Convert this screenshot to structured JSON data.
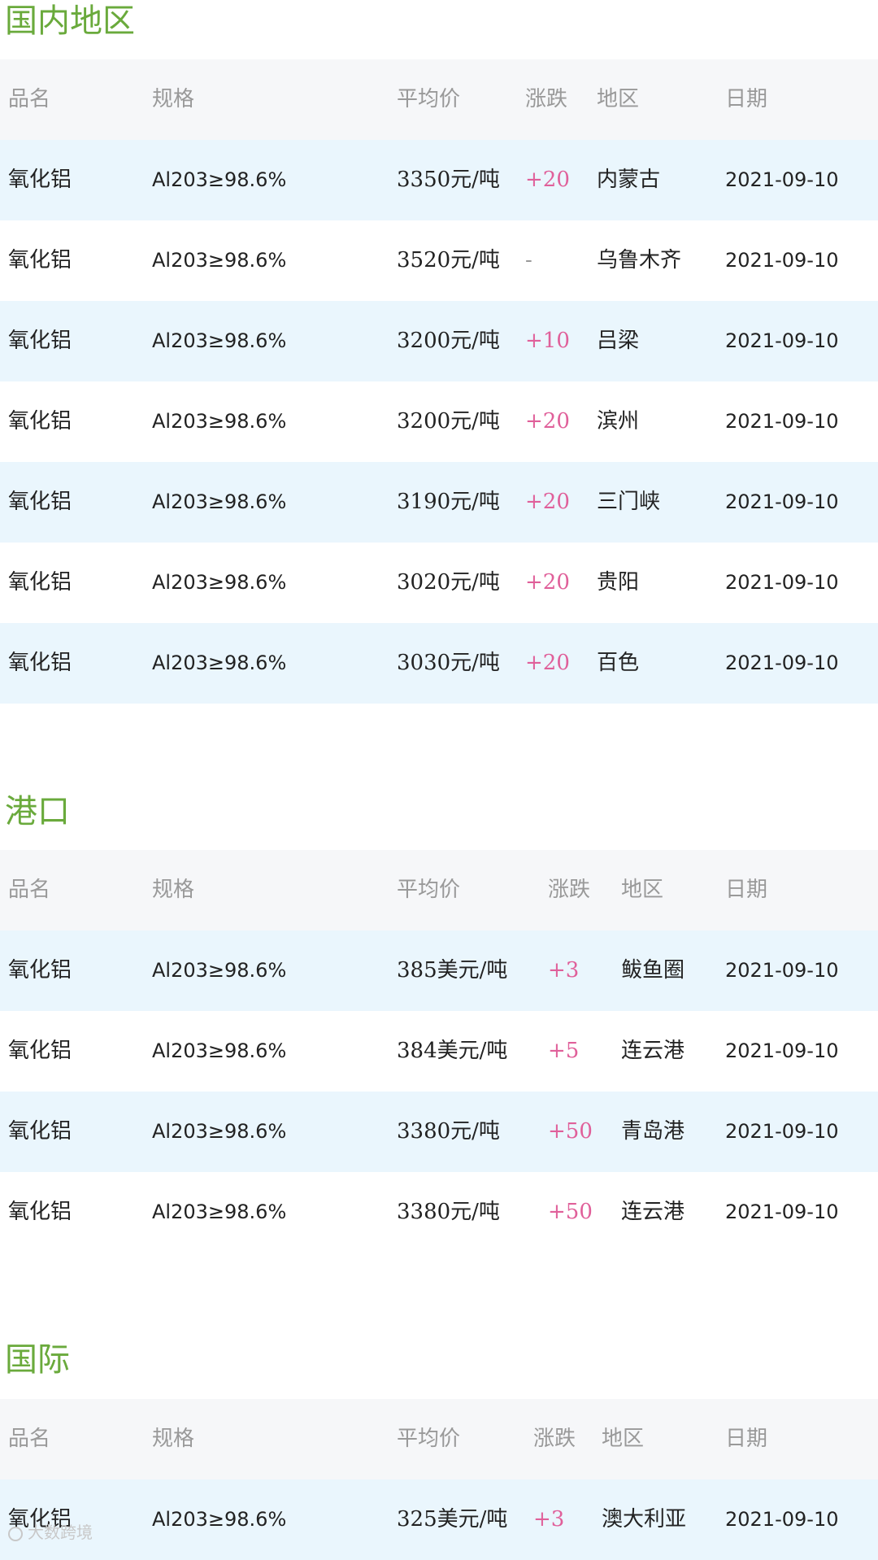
{
  "headers": {
    "name": "品名",
    "spec": "规格",
    "price": "平均价",
    "change": "涨跌",
    "region": "地区",
    "date": "日期"
  },
  "domestic": {
    "title": "国内地区",
    "rows": [
      {
        "name": "氧化铝",
        "spec": "Al203≥98.6%",
        "price": "3350元/吨",
        "change": "+20",
        "region": "内蒙古",
        "date": "2021-09-10"
      },
      {
        "name": "氧化铝",
        "spec": "Al203≥98.6%",
        "price": "3520元/吨",
        "change": "-",
        "region": "乌鲁木齐",
        "date": "2021-09-10"
      },
      {
        "name": "氧化铝",
        "spec": "Al203≥98.6%",
        "price": "3200元/吨",
        "change": "+10",
        "region": "吕梁",
        "date": "2021-09-10"
      },
      {
        "name": "氧化铝",
        "spec": "Al203≥98.6%",
        "price": "3200元/吨",
        "change": "+20",
        "region": "滨州",
        "date": "2021-09-10"
      },
      {
        "name": "氧化铝",
        "spec": "Al203≥98.6%",
        "price": "3190元/吨",
        "change": "+20",
        "region": "三门峡",
        "date": "2021-09-10"
      },
      {
        "name": "氧化铝",
        "spec": "Al203≥98.6%",
        "price": "3020元/吨",
        "change": "+20",
        "region": "贵阳",
        "date": "2021-09-10"
      },
      {
        "name": "氧化铝",
        "spec": "Al203≥98.6%",
        "price": "3030元/吨",
        "change": "+20",
        "region": "百色",
        "date": "2021-09-10"
      }
    ]
  },
  "port": {
    "title": "港口",
    "rows": [
      {
        "name": "氧化铝",
        "spec": "Al203≥98.6%",
        "price": "385美元/吨",
        "change": "+3",
        "region": "鲅鱼圈",
        "date": "2021-09-10"
      },
      {
        "name": "氧化铝",
        "spec": "Al203≥98.6%",
        "price": "384美元/吨",
        "change": "+5",
        "region": "连云港",
        "date": "2021-09-10"
      },
      {
        "name": "氧化铝",
        "spec": "Al203≥98.6%",
        "price": "3380元/吨",
        "change": "+50",
        "region": "青岛港",
        "date": "2021-09-10"
      },
      {
        "name": "氧化铝",
        "spec": "Al203≥98.6%",
        "price": "3380元/吨",
        "change": "+50",
        "region": "连云港",
        "date": "2021-09-10"
      }
    ]
  },
  "international": {
    "title": "国际",
    "rows": [
      {
        "name": "氧化铝",
        "spec": "Al203≥98.6%",
        "price": "325美元/吨",
        "change": "+3",
        "region": "澳大利亚",
        "date": "2021-09-10"
      }
    ]
  },
  "watermark": "大数跨境",
  "colors": {
    "title_green": "#6aaa3c",
    "change_pink": "#e0609a",
    "row_shade": "#eaf6fd",
    "header_bg": "#f6f7f9"
  }
}
